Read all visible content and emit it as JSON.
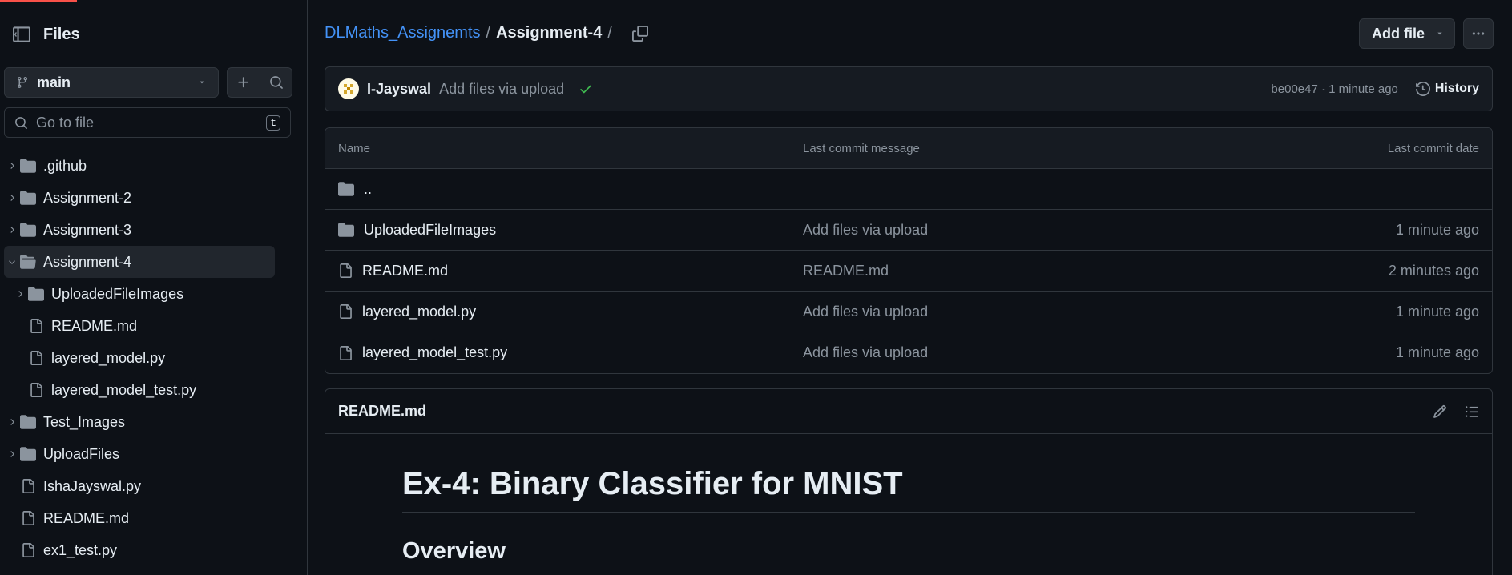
{
  "sidebar": {
    "title": "Files",
    "branch": "main",
    "goto": {
      "placeholder": "Go to file",
      "shortcut": "t"
    },
    "tree": [
      {
        "label": ".github",
        "type": "folder",
        "expanded": false,
        "depth": 0
      },
      {
        "label": "Assignment-2",
        "type": "folder",
        "expanded": false,
        "depth": 0
      },
      {
        "label": "Assignment-3",
        "type": "folder",
        "expanded": false,
        "depth": 0
      },
      {
        "label": "Assignment-4",
        "type": "folder",
        "expanded": true,
        "depth": 0,
        "active": true
      },
      {
        "label": "UploadedFileImages",
        "type": "folder",
        "expanded": false,
        "depth": 1
      },
      {
        "label": "README.md",
        "type": "file",
        "depth": 1
      },
      {
        "label": "layered_model.py",
        "type": "file",
        "depth": 1
      },
      {
        "label": "layered_model_test.py",
        "type": "file",
        "depth": 1
      },
      {
        "label": "Test_Images",
        "type": "folder",
        "expanded": false,
        "depth": 0
      },
      {
        "label": "UploadFiles",
        "type": "folder",
        "expanded": false,
        "depth": 0
      },
      {
        "label": "IshaJayswal.py",
        "type": "file",
        "depth": 0
      },
      {
        "label": "README.md",
        "type": "file",
        "depth": 0
      },
      {
        "label": "ex1_test.py",
        "type": "file",
        "depth": 0
      }
    ]
  },
  "breadcrumb": {
    "repo": "DLMaths_Assignemts",
    "sep1": "/",
    "current": "Assignment-4",
    "sep2": "/"
  },
  "actions": {
    "add_file": "Add file"
  },
  "commit": {
    "author": "I-Jayswal",
    "message": "Add files via upload",
    "meta": "be00e47 · 1 minute ago",
    "history": "History"
  },
  "file_table": {
    "headers": {
      "name": "Name",
      "message": "Last commit message",
      "date": "Last commit date"
    },
    "parent": "..",
    "rows": [
      {
        "name": "UploadedFileImages",
        "type": "folder",
        "message": "Add files via upload",
        "date": "1 minute ago"
      },
      {
        "name": "README.md",
        "type": "file",
        "message": "README.md",
        "date": "2 minutes ago"
      },
      {
        "name": "layered_model.py",
        "type": "file",
        "message": "Add files via upload",
        "date": "1 minute ago"
      },
      {
        "name": "layered_model_test.py",
        "type": "file",
        "message": "Add files via upload",
        "date": "1 minute ago"
      }
    ]
  },
  "readme": {
    "title": "README.md",
    "h1": "Ex-4: Binary Classifier for MNIST",
    "h2": "Overview"
  },
  "colors": {
    "bg": "#0d1117",
    "panel": "#161b22",
    "border": "#30363d",
    "link": "#4493f8",
    "muted": "#8b949e",
    "success": "#3fb950",
    "accent_bar": "#f85149"
  }
}
